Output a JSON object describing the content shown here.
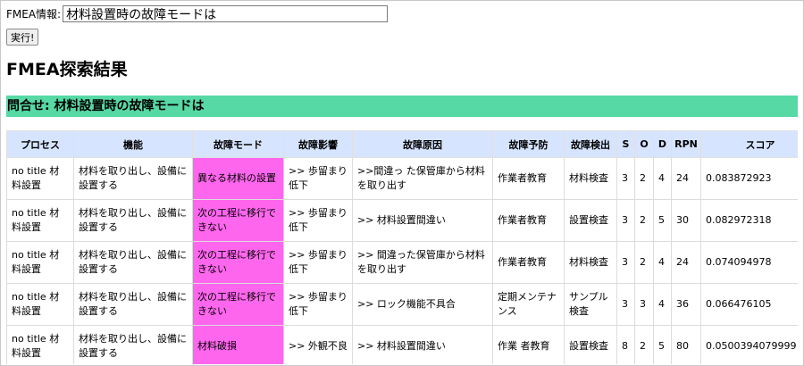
{
  "query": {
    "label": "FMEA情報:",
    "value": "材料設置時の故障モードは",
    "run_label": "実行!"
  },
  "page_title": "FMEA探索結果",
  "banner": "問合せ: 材料設置時の故障モードは",
  "table": {
    "headers": [
      "プロセス",
      "機能",
      "故障モード",
      "故障影響",
      "故障原因",
      "故障予防",
      "故障検出",
      "S",
      "O",
      "D",
      "RPN",
      "スコア"
    ],
    "rows": [
      [
        "no title 材料設置",
        "材料を取り出し、設備に設置する",
        "異なる材料の設置",
        ">> 歩留まり低下",
        ">>間違っ た保管庫から材料を取り出す",
        "作業者教育",
        "材料検査",
        "3",
        "2",
        "4",
        "24",
        "0.083872923"
      ],
      [
        "no title 材料設置",
        "材料を取り出し、設備に設置する",
        "次の工程に移行できない",
        ">> 歩留まり低下",
        ">> 材料設置間違い",
        "作業者教育",
        "設置検査",
        "3",
        "2",
        "5",
        "30",
        "0.082972318"
      ],
      [
        "no title 材料設置",
        "材料を取り出し、設備に設置する",
        "次の工程に移行できない",
        ">> 歩留まり低下",
        ">> 間違った保管庫から材料を取り出す",
        "作業者教育",
        "材料検査",
        "3",
        "2",
        "4",
        "24",
        "0.074094978"
      ],
      [
        "no title 材料設置",
        "材料を取り出し、設備に設置する",
        "次の工程に移行できない",
        ">> 歩留まり低下",
        ">> ロック機能不具合",
        "定期メンテナンス",
        "サンプル検査",
        "3",
        "3",
        "4",
        "36",
        "0.066476105"
      ],
      [
        "no title 材料設置",
        "材料を取り出し、設備に設置する",
        "材料破損",
        ">> 外観不良",
        ">> 材料設置間違い",
        "作業 者教育",
        "設置検査",
        "8",
        "2",
        "5",
        "80",
        "0.0500394079999"
      ]
    ]
  },
  "colors": {
    "banner": "#56d9a5",
    "header": "#d6e4ff",
    "failure_mode_highlight": "#ff66ee"
  }
}
